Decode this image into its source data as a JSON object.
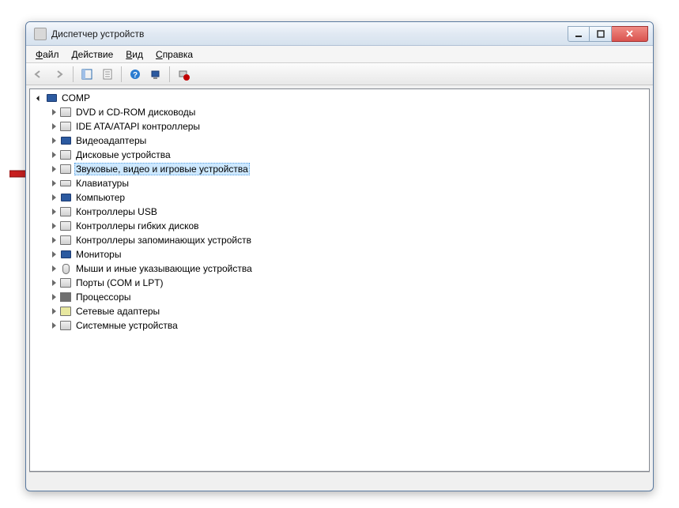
{
  "titlebar": {
    "title": "Диспетчер устройств"
  },
  "menu": {
    "file": "Файл",
    "action": "Действие",
    "view": "Вид",
    "help": "Справка"
  },
  "tree": {
    "root": "COMP",
    "items": [
      "DVD и CD-ROM дисководы",
      "IDE ATA/ATAPI контроллеры",
      "Видеоадаптеры",
      "Дисковые устройства",
      "Звуковые, видео и игровые устройства",
      "Клавиатуры",
      "Компьютер",
      "Контроллеры USB",
      "Контроллеры гибких дисков",
      "Контроллеры запоминающих устройств",
      "Мониторы",
      "Мыши и иные указывающие устройства",
      "Порты (COM и LPT)",
      "Процессоры",
      "Сетевые адаптеры",
      "Системные устройства"
    ],
    "selected_index": 4
  }
}
